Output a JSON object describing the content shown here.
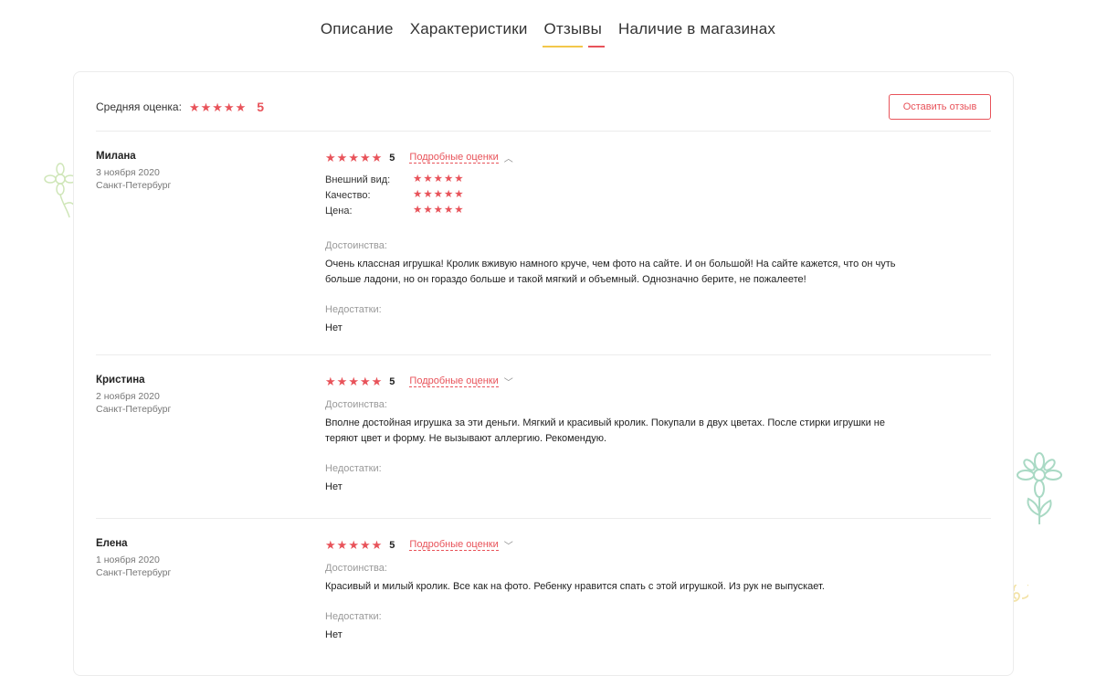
{
  "tabs": [
    {
      "label": "Описание"
    },
    {
      "label": "Характеристики"
    },
    {
      "label": "Отзывы"
    },
    {
      "label": "Наличие в магазинах"
    }
  ],
  "active_tab": "Отзывы",
  "summary": {
    "avg_label": "Средняя оценка:",
    "avg_value": "5",
    "leave_button": "Оставить отзыв"
  },
  "colors": {
    "accent": "#e8535a",
    "yellow": "#f3c74a",
    "deco": "#a9d9c4"
  },
  "reviews": [
    {
      "name": "Милана",
      "date": "3 ноября 2020",
      "city": "Санкт-Петербург",
      "rating": "5",
      "details_label": "Подробные оценки",
      "expanded": true,
      "sub_ratings": [
        {
          "label": "Внешний вид:"
        },
        {
          "label": "Качество:"
        },
        {
          "label": "Цена:"
        }
      ],
      "pros_label": "Достоинства:",
      "pros_line1": "Очень классная игрушка! Кролик вживую намного круче, чем фото на сайте. И он большой! На сайте кажется, что он чуть",
      "pros_line2": "больше ладони, но он гораздо больше и такой мягкий и объемный. Однозначно берите, не пожалеете!",
      "cons_label": "Недостатки:",
      "cons": "Нет"
    },
    {
      "name": "Кристина",
      "date": "2 ноября 2020",
      "city": "Санкт-Петербург",
      "rating": "5",
      "details_label": "Подробные оценки",
      "expanded": false,
      "pros_label": "Достоинства:",
      "pros_line1": "Вполне достойная игрушка за эти деньги. Мягкий и красивый кролик. Покупали в двух цветах. После стирки игрушки не",
      "pros_line2": "теряют цвет и форму. Не вызывают аллергию. Рекомендую.",
      "cons_label": "Недостатки:",
      "cons": "Нет"
    },
    {
      "name": "Елена",
      "date": "1 ноября 2020",
      "city": "Санкт-Петербург",
      "rating": "5",
      "details_label": "Подробные оценки",
      "expanded": false,
      "pros_label": "Достоинства:",
      "pros_line1": "Красивый и милый кролик. Все как на фото. Ребенку нравится спать с этой игрушкой. Из рук не выпускает.",
      "cons_label": "Недостатки:",
      "cons": "Нет"
    }
  ]
}
